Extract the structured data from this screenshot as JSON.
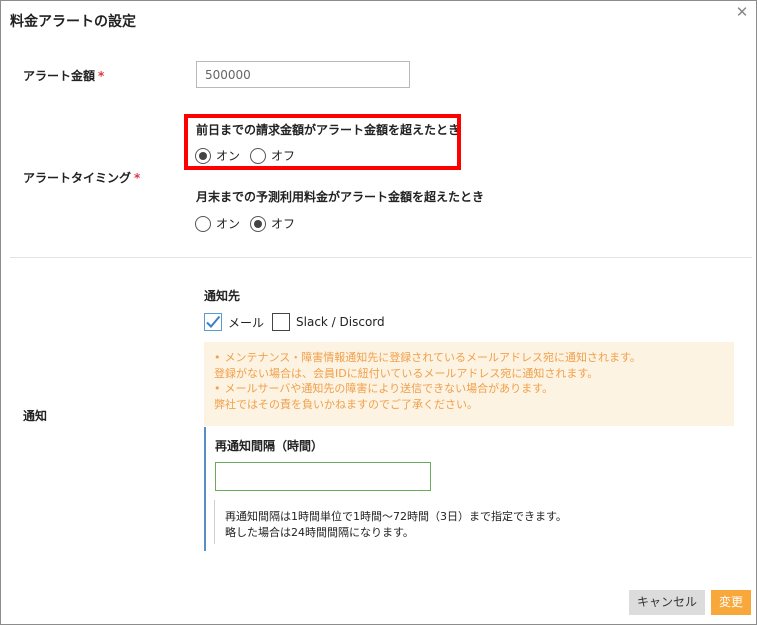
{
  "dialog": {
    "title": "料金アラートの設定",
    "close_icon": "close-icon"
  },
  "amount": {
    "label": "アラート金額",
    "required_mark": "*",
    "value": "500000"
  },
  "timing": {
    "label": "アラートタイミング",
    "required_mark": "*",
    "previous_day": {
      "label": "前日までの請求金額がアラート金額を超えたとき",
      "on_label": "オン",
      "off_label": "オフ",
      "selected": "on",
      "highlight_color": "#ff0000"
    },
    "month_end": {
      "label": "月末までの予測利用料金がアラート金額を超えたとき",
      "on_label": "オン",
      "off_label": "オフ",
      "selected": "off"
    }
  },
  "notification": {
    "label": "通知",
    "destination_label": "通知先",
    "mail_label": "メール",
    "mail_checked": true,
    "slack_label": "Slack / Discord",
    "slack_checked": false,
    "notice": {
      "line1": "メンテナンス・障害情報通知先に登録されているメールアドレス宛に通知されます。",
      "line2": "登録がない場合は、会員IDに紐付いているメールアドレス宛に通知されます。",
      "line3": "メールサーバや通知先の障害により送信できない場合があります。",
      "line4": "弊社ではその責を負いかねますのでご了承ください。",
      "bullet": "•",
      "text_color": "#f0a04b",
      "bg_color": "#fdf3e3"
    },
    "renotify_label": "再通知間隔（時間）",
    "renotify_value": "",
    "help": {
      "line1": "再通知間隔は1時間単位で1時間～72時間（3日）まで指定できます。",
      "line2": "略した場合は24時間間隔になります。"
    }
  },
  "buttons": {
    "cancel": "キャンセル",
    "save": "変更",
    "save_color": "#f8a73b"
  }
}
